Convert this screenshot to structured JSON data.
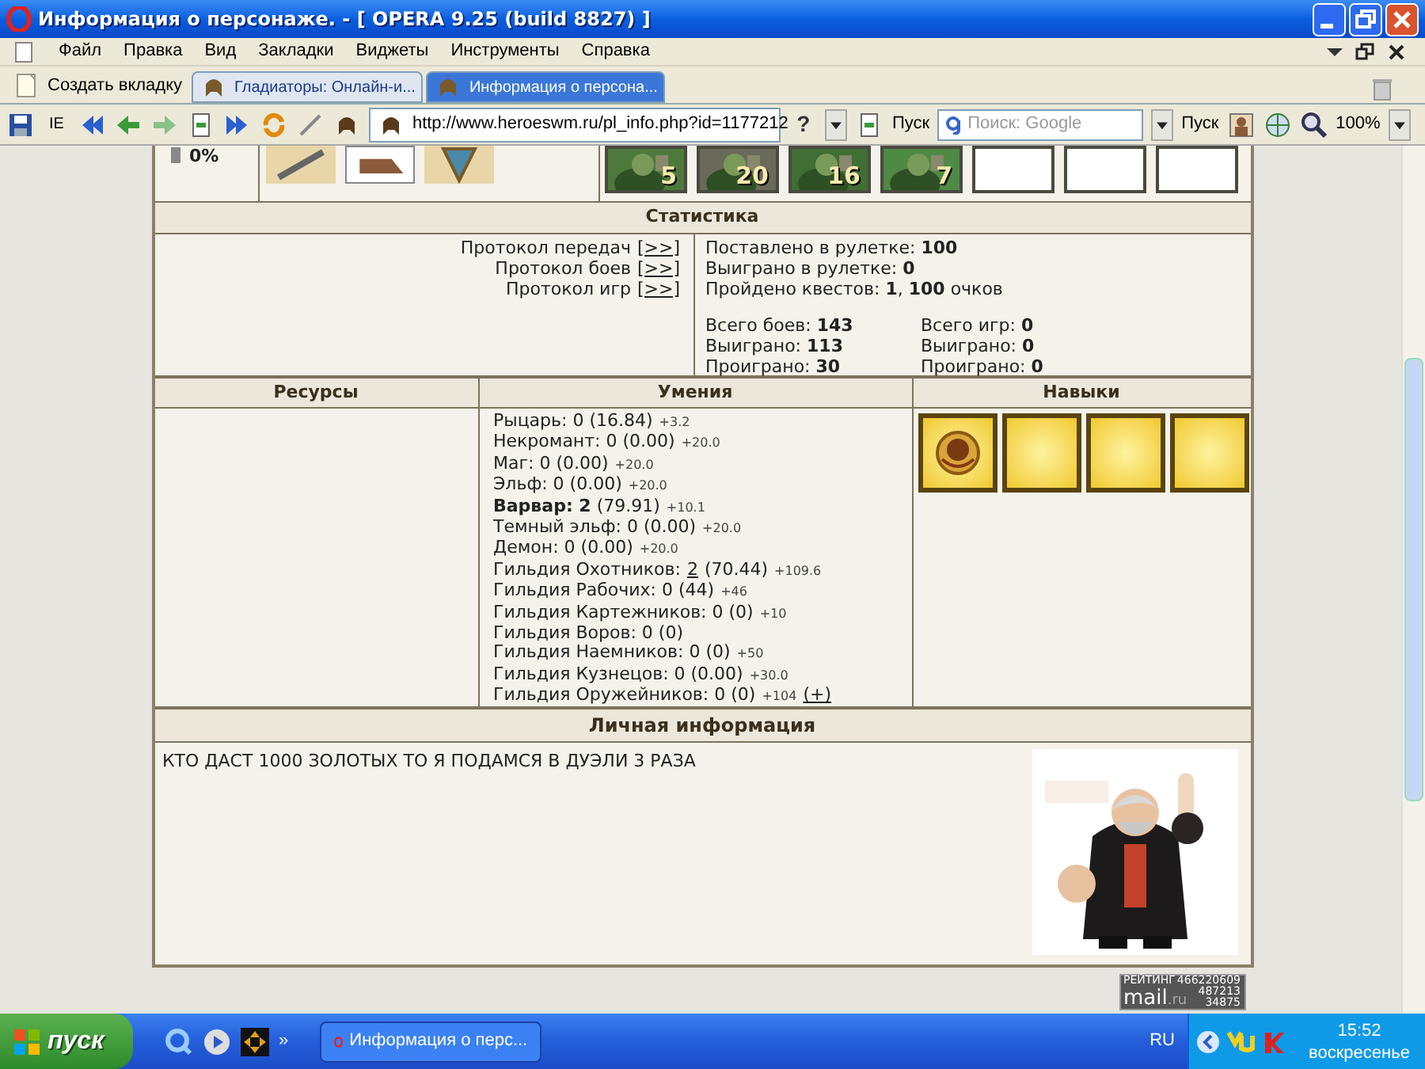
{
  "window": {
    "title": "Информация о персонаже. - [ OPERA 9.25 (build 8827) ]"
  },
  "menu": [
    "Файл",
    "Правка",
    "Вид",
    "Закладки",
    "Виджеты",
    "Инструменты",
    "Справка"
  ],
  "new_tab": "Создать вкладку",
  "tabs": [
    {
      "label": "Гладиаторы: Онлайн-и...",
      "selected": false
    },
    {
      "label": "Информация о персона...",
      "selected": true
    }
  ],
  "toolbar": {
    "ie_label": "IE",
    "address": "http://www.heroeswm.ru/pl_info.php?id=1177212",
    "help": "?",
    "go_label": "Пуск",
    "search_placeholder": "Поиск: Google",
    "search_go_label": "Пуск",
    "zoom": "100%"
  },
  "character": {
    "percent": "0%",
    "army": [
      {
        "kind": "creature",
        "count": "5"
      },
      {
        "kind": "creature",
        "count": "20"
      },
      {
        "kind": "creature",
        "count": "16"
      },
      {
        "kind": "creature",
        "count": "7"
      },
      {
        "kind": "empty"
      },
      {
        "kind": "empty"
      },
      {
        "kind": "empty"
      }
    ]
  },
  "statistics": {
    "title": "Статистика",
    "protocols": [
      {
        "label": "Протокол передач",
        "link": "[>>]"
      },
      {
        "label": "Протокол боев",
        "link": "[>>]"
      },
      {
        "label": "Протокол игр",
        "link": "[>>]"
      }
    ],
    "roulette": [
      "Поставлено в рулетке: **100**",
      "Выиграно в рулетке: **0**",
      "Пройдено квестов: **1**, **100** очков"
    ],
    "battles": [
      "Всего боев: **143**",
      "Выиграно: **113**",
      "Проиграно: **30**"
    ],
    "games": [
      "Всего игр: **0**",
      "Выиграно: **0**",
      "Проиграно: **0**"
    ]
  },
  "resources": {
    "title": "Ресурсы"
  },
  "skills": {
    "title": "Умения",
    "factions": [
      {
        "text": "Рыцарь: 0 (16.84)",
        "bonus": "+3.2"
      },
      {
        "text": "Некромант: 0 (0.00)",
        "bonus": "+20.0"
      },
      {
        "text": "Маг: 0 (0.00)",
        "bonus": "+20.0"
      },
      {
        "text": "Эльф: 0 (0.00)",
        "bonus": "+20.0"
      },
      {
        "text": "**Варвар: 2** (79.91)",
        "bonus": "+10.1"
      },
      {
        "text": "Темный эльф: 0 (0.00)",
        "bonus": "+20.0"
      },
      {
        "text": "Демон: 0 (0.00)",
        "bonus": "+20.0"
      }
    ],
    "guilds": [
      {
        "text": "Гильдия Охотников:",
        "link": "2",
        "after": "(70.44)",
        "bonus": "+109.6"
      },
      {
        "text": "Гильдия Рабочих: 0 (44)",
        "bonus": "+46"
      },
      {
        "text": "Гильдия Картежников: 0 (0)",
        "bonus": "+10"
      },
      {
        "text": "Гильдия Воров: 0 (0)"
      },
      {
        "text": "Гильдия Наемников: 0 (0)",
        "bonus": "+50"
      },
      {
        "text": "Гильдия Кузнецов: 0 (0.00)",
        "bonus": "+30.0"
      },
      {
        "text": "Гильдия Оружейников: 0 (0)",
        "bonus": "+104",
        "action": "(+)"
      }
    ]
  },
  "talents": {
    "title": "Навыки",
    "slots": [
      {
        "kind": "emblem"
      },
      {
        "kind": "empty"
      },
      {
        "kind": "empty"
      },
      {
        "kind": "empty"
      }
    ]
  },
  "personal": {
    "title": "Личная информация",
    "text": "КТО ДАСТ 1000 ЗОЛОТЫХ ТО Я ПОДАМСЯ В ДУЭЛИ 3 РАЗА"
  },
  "counter": {
    "label": "РЕЙТИНГ",
    "rank": "466220609",
    "brand": "mail",
    "brand_suffix": ".ru",
    "stat1": "487213",
    "stat2": "34875"
  },
  "taskbar": {
    "start": "пуск",
    "more": "»",
    "tasks": [
      {
        "label": "Информация о перс..."
      }
    ],
    "language": "RU",
    "time": "15:52",
    "day": "воскресенье"
  }
}
